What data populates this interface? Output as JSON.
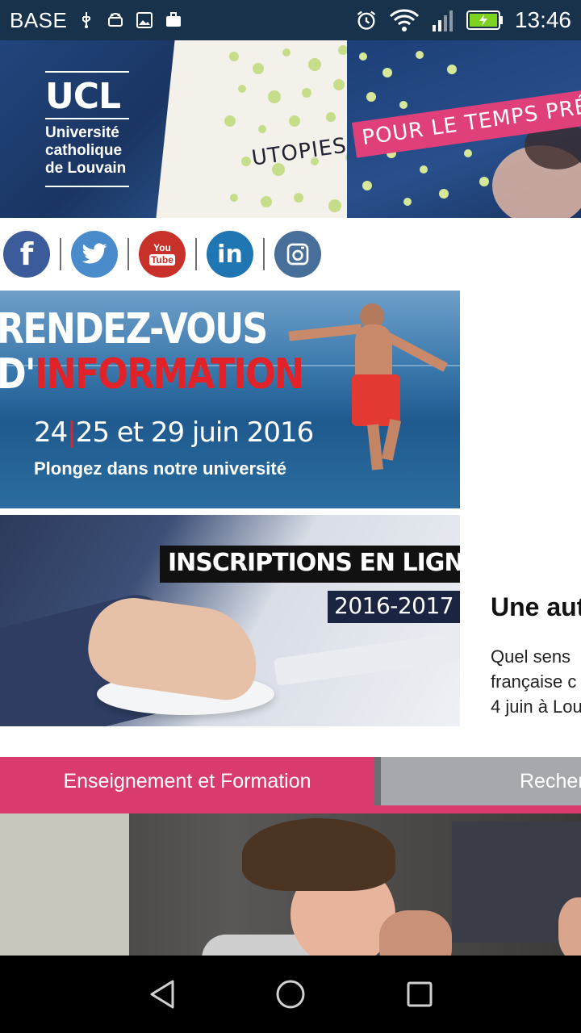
{
  "status_bar": {
    "carrier": "BASE",
    "time": "13:46",
    "left_icons": [
      "usb-icon",
      "android-icon",
      "image-icon",
      "briefcase-icon"
    ],
    "right_icons": [
      "alarm-icon",
      "wifi-icon",
      "signal-icon",
      "battery-charging-icon"
    ]
  },
  "banner": {
    "logo_short": "UCL",
    "logo_line1": "Université",
    "logo_line2": "catholique",
    "logo_line3": "de Louvain",
    "tagline_dark": "UTOPIES",
    "tagline_pink": "POUR LE TEMPS PRÉ"
  },
  "social": {
    "icons": [
      "facebook-icon",
      "twitter-icon",
      "youtube-icon",
      "linkedin-icon",
      "instagram-icon"
    ],
    "facebook_glyph": "f",
    "youtube_top": "You",
    "youtube_bottom": "Tube",
    "linkedin_glyph": "in"
  },
  "promo_info": {
    "line1": "RENDEZ-VOUS",
    "line2_white": "D'",
    "line2_red": "INFORMATION",
    "date_a": "24",
    "date_sep": "|",
    "date_b": "25 et 29 juin 2016",
    "subtitle": "Plongez dans notre université"
  },
  "promo_inscriptions": {
    "line1": "INSCRIPTIONS EN LIGNE",
    "line2": "2016-2017"
  },
  "article": {
    "title": "Une aut",
    "body_line1": "Quel sens",
    "body_line2": "française c",
    "body_line3": "4 juin à Lou"
  },
  "tabs": {
    "active": "Enseignement et Formation",
    "inactive": "Recher"
  },
  "colors": {
    "status_bar": "#17324a",
    "accent_pink": "#d93b6e",
    "tab_inactive": "#a6a8ad",
    "info_red": "#e12329"
  }
}
